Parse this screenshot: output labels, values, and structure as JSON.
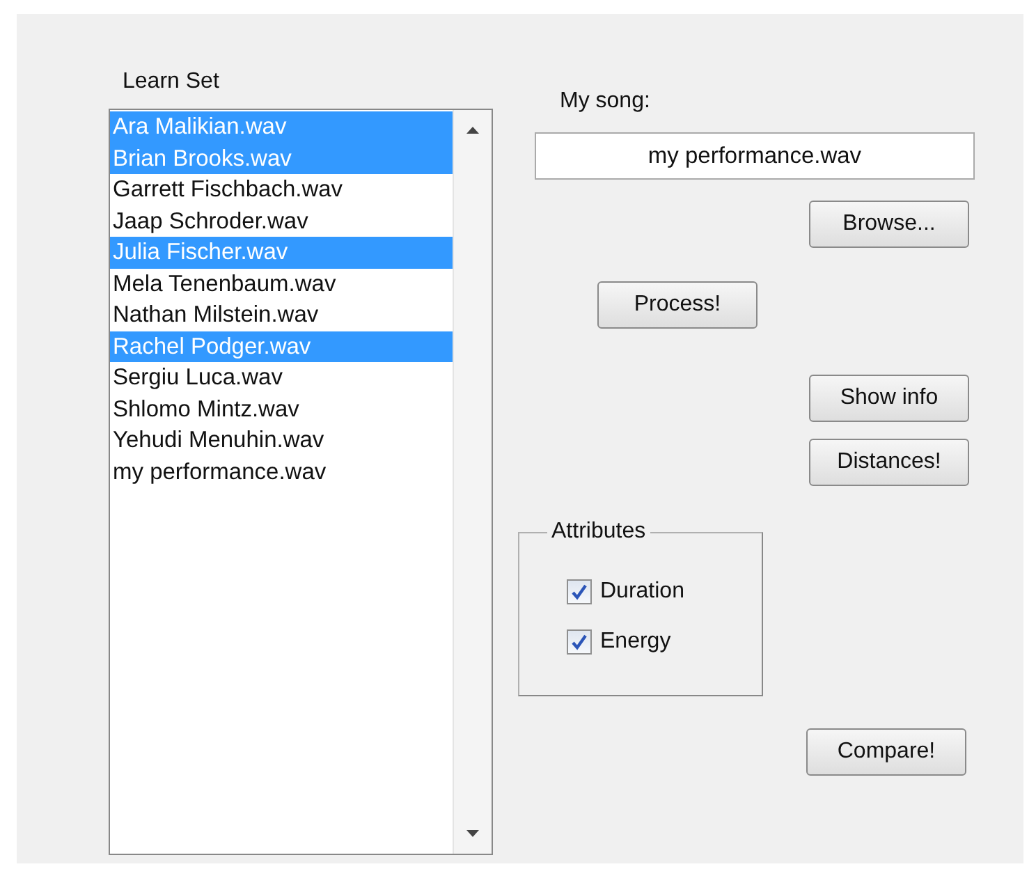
{
  "learn_set": {
    "label": "Learn Set",
    "items": [
      {
        "name": "Ara Malikian.wav",
        "selected": true
      },
      {
        "name": "Brian Brooks.wav",
        "selected": true
      },
      {
        "name": "Garrett Fischbach.wav",
        "selected": false
      },
      {
        "name": "Jaap Schroder.wav",
        "selected": false
      },
      {
        "name": "Julia Fischer.wav",
        "selected": true
      },
      {
        "name": "Mela Tenenbaum.wav",
        "selected": false
      },
      {
        "name": "Nathan Milstein.wav",
        "selected": false
      },
      {
        "name": "Rachel Podger.wav",
        "selected": true
      },
      {
        "name": "Sergiu Luca.wav",
        "selected": false
      },
      {
        "name": "Shlomo Mintz.wav",
        "selected": false
      },
      {
        "name": "Yehudi Menuhin.wav",
        "selected": false
      },
      {
        "name": "my performance.wav",
        "selected": false
      }
    ]
  },
  "my_song": {
    "label": "My song:",
    "value": "my performance.wav"
  },
  "browse_button": "Browse...",
  "process_button": "Process!",
  "show_info_button": "Show info",
  "distances_button": "Distances!",
  "attributes": {
    "title": "Attributes",
    "options": [
      {
        "label": "Duration",
        "checked": true
      },
      {
        "label": "Energy",
        "checked": true
      }
    ]
  },
  "compare_button": "Compare!"
}
